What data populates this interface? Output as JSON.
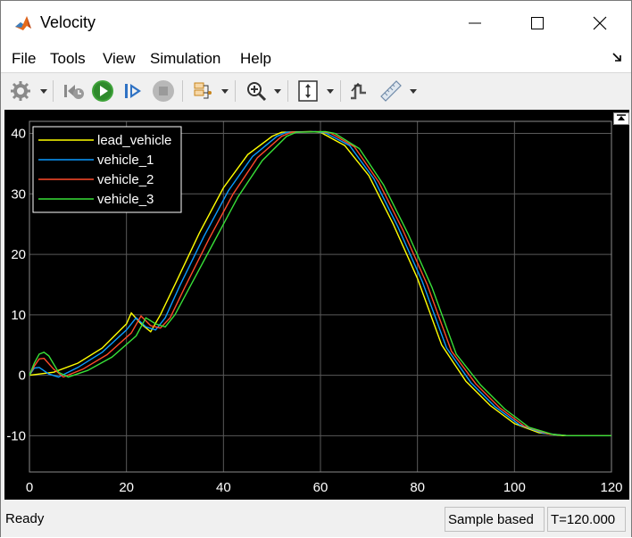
{
  "window": {
    "title": "Velocity",
    "app_icon": "matlab-icon",
    "controls": {
      "minimize": "minimize-icon",
      "maximize": "maximize-icon",
      "close": "close-icon"
    }
  },
  "menu": {
    "items": [
      "File",
      "Tools",
      "View",
      "Simulation",
      "Help"
    ],
    "undock_icon": "undock-arrow-icon"
  },
  "toolbar": {
    "icons": [
      "settings-gear-icon",
      "step-back-icon",
      "run-icon",
      "step-forward-icon",
      "stop-icon",
      "signal-selector-icon",
      "zoom-in-icon",
      "scale-axes-icon",
      "triggers-icon",
      "measurements-ruler-icon"
    ]
  },
  "status": {
    "ready": "Ready",
    "mode": "Sample based",
    "time": "T=120.000"
  },
  "colors": {
    "plot_background": "#000000",
    "grid": "#5a5a5a",
    "axis_text": "#ffffff",
    "lead_vehicle": "#ffff00",
    "vehicle_1": "#0b9bff",
    "vehicle_2": "#ff4a2a",
    "vehicle_3": "#38e038"
  },
  "chart_data": {
    "type": "line",
    "title": "",
    "xlabel": "",
    "ylabel": "",
    "xlim": [
      0,
      120
    ],
    "ylim": [
      -16,
      42
    ],
    "xticks": [
      0,
      20,
      40,
      60,
      80,
      100,
      120
    ],
    "yticks": [
      -10,
      0,
      10,
      20,
      30,
      40
    ],
    "grid": true,
    "legend_position": "top-left",
    "series": [
      {
        "name": "lead_vehicle",
        "color": "#ffff00",
        "points": [
          [
            0,
            0
          ],
          [
            5,
            0.5
          ],
          [
            10,
            2
          ],
          [
            15,
            4.5
          ],
          [
            20,
            8.5
          ],
          [
            21,
            10.3
          ],
          [
            23,
            8.5
          ],
          [
            25,
            7.2
          ],
          [
            27,
            10
          ],
          [
            30,
            15
          ],
          [
            35,
            23.5
          ],
          [
            40,
            31
          ],
          [
            45,
            36.5
          ],
          [
            50,
            39.5
          ],
          [
            52,
            40.2
          ],
          [
            58,
            40.3
          ],
          [
            60,
            40.2
          ],
          [
            65,
            38
          ],
          [
            70,
            33
          ],
          [
            75,
            25
          ],
          [
            80,
            16
          ],
          [
            85,
            5
          ],
          [
            90,
            -1
          ],
          [
            95,
            -5
          ],
          [
            100,
            -8
          ],
          [
            105,
            -9.5
          ],
          [
            110,
            -10
          ],
          [
            120,
            -10
          ]
        ]
      },
      {
        "name": "vehicle_1",
        "color": "#0b9bff",
        "points": [
          [
            0,
            0
          ],
          [
            1,
            1.2
          ],
          [
            2,
            1.3
          ],
          [
            4,
            0.2
          ],
          [
            6,
            -0.3
          ],
          [
            10,
            1.3
          ],
          [
            15,
            3.8
          ],
          [
            20,
            7.5
          ],
          [
            22,
            9.5
          ],
          [
            24,
            8
          ],
          [
            26,
            7.5
          ],
          [
            28,
            9.5
          ],
          [
            31,
            14.8
          ],
          [
            36,
            23
          ],
          [
            41,
            30.5
          ],
          [
            46,
            36.2
          ],
          [
            51,
            39.5
          ],
          [
            53,
            40.2
          ],
          [
            59,
            40.3
          ],
          [
            61,
            40.1
          ],
          [
            66,
            38
          ],
          [
            71,
            32.5
          ],
          [
            76,
            24.5
          ],
          [
            81,
            15.5
          ],
          [
            86,
            4.5
          ],
          [
            91,
            -1.2
          ],
          [
            96,
            -5.2
          ],
          [
            101,
            -8.2
          ],
          [
            106,
            -9.6
          ],
          [
            111,
            -10
          ],
          [
            120,
            -10
          ]
        ]
      },
      {
        "name": "vehicle_2",
        "color": "#ff4a2a",
        "points": [
          [
            0,
            0
          ],
          [
            1,
            1.5
          ],
          [
            2,
            2.7
          ],
          [
            3,
            2.8
          ],
          [
            5,
            1
          ],
          [
            7,
            -0.3
          ],
          [
            11,
            1
          ],
          [
            16,
            3.4
          ],
          [
            21,
            7
          ],
          [
            23,
            9.8
          ],
          [
            25,
            8.2
          ],
          [
            27,
            7.8
          ],
          [
            29,
            9.5
          ],
          [
            32,
            14.5
          ],
          [
            37,
            22.5
          ],
          [
            42,
            30
          ],
          [
            47,
            36
          ],
          [
            52,
            39.5
          ],
          [
            54,
            40.2
          ],
          [
            60,
            40.3
          ],
          [
            62,
            40.1
          ],
          [
            67,
            37.8
          ],
          [
            72,
            32
          ],
          [
            77,
            24
          ],
          [
            82,
            15
          ],
          [
            87,
            4
          ],
          [
            92,
            -1.4
          ],
          [
            97,
            -5.4
          ],
          [
            102,
            -8.4
          ],
          [
            107,
            -9.7
          ],
          [
            111,
            -10
          ],
          [
            120,
            -10
          ]
        ]
      },
      {
        "name": "vehicle_3",
        "color": "#38e038",
        "points": [
          [
            0,
            0
          ],
          [
            1,
            2
          ],
          [
            2,
            3.5
          ],
          [
            3,
            3.8
          ],
          [
            4,
            3.2
          ],
          [
            6,
            0.5
          ],
          [
            8,
            -0.3
          ],
          [
            12,
            0.8
          ],
          [
            17,
            3
          ],
          [
            22,
            6.5
          ],
          [
            24,
            9.5
          ],
          [
            26,
            8.5
          ],
          [
            28,
            8
          ],
          [
            30,
            10
          ],
          [
            33,
            14.5
          ],
          [
            38,
            22
          ],
          [
            43,
            29.5
          ],
          [
            48,
            35.5
          ],
          [
            53,
            39.5
          ],
          [
            55,
            40.2
          ],
          [
            61,
            40.3
          ],
          [
            63,
            40
          ],
          [
            68,
            37.5
          ],
          [
            73,
            31.5
          ],
          [
            78,
            23.5
          ],
          [
            83,
            14.5
          ],
          [
            88,
            3.5
          ],
          [
            93,
            -1.6
          ],
          [
            98,
            -5.6
          ],
          [
            103,
            -8.6
          ],
          [
            108,
            -9.8
          ],
          [
            111,
            -10
          ],
          [
            120,
            -10
          ]
        ]
      }
    ]
  }
}
